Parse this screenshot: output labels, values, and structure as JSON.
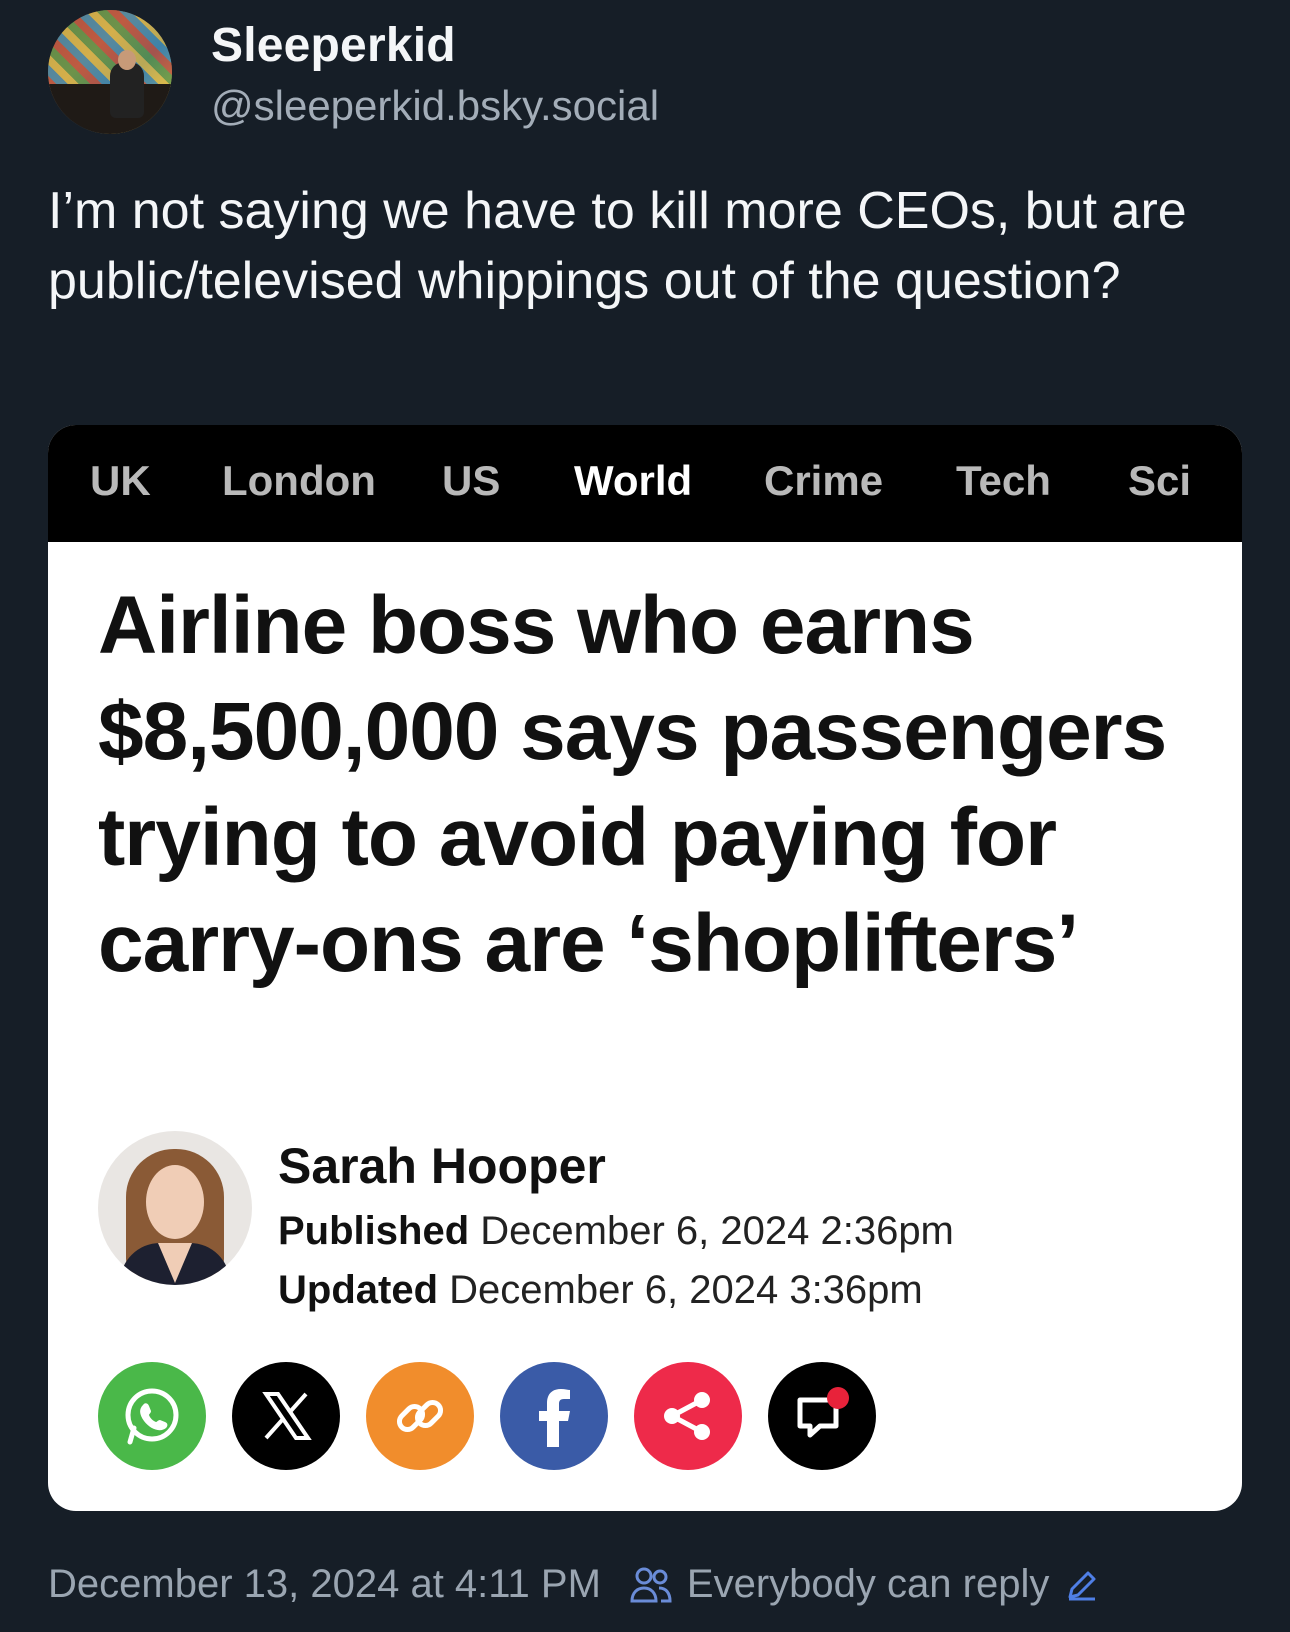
{
  "post": {
    "display_name": "Sleeperkid",
    "handle": "@sleeperkid.bsky.social",
    "text": "I’m not saying we have to kill more CEOs, but are public/televised whippings out of the question?",
    "timestamp": "December 13, 2024 at 4:11 PM",
    "reply_setting": "Everybody can reply"
  },
  "embed": {
    "nav": [
      "UK",
      "London",
      "US",
      "World",
      "Crime",
      "Tech",
      "Sci"
    ],
    "active_nav": "World",
    "headline": "Airline boss who earns $8,500,000 says passengers trying to avoid paying for carry-ons are ‘shoplifters’",
    "author": "Sarah Hooper",
    "published_label": "Published",
    "published_value": "December 6, 2024 2:36pm",
    "updated_label": "Updated",
    "updated_value": "December 6, 2024 3:36pm",
    "share_icons": [
      "whatsapp-icon",
      "x-icon",
      "link-icon",
      "facebook-icon",
      "share-icon",
      "comment-icon"
    ]
  },
  "colors": {
    "background": "#161e27",
    "whatsapp": "#4ab849",
    "x": "#000000",
    "link": "#f18d2c",
    "facebook": "#3a5ba7",
    "share": "#ee2a4a",
    "comment_dot": "#e8223a",
    "reply_icon": "#6a8cd8"
  }
}
